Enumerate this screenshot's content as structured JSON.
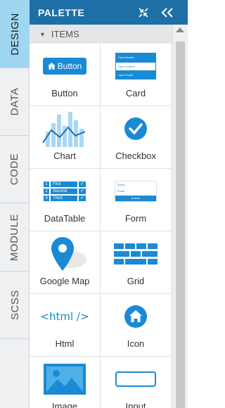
{
  "tabs": [
    {
      "label": "DESIGN",
      "active": true
    },
    {
      "label": "DATA",
      "active": false
    },
    {
      "label": "CODE",
      "active": false
    },
    {
      "label": "MODULE",
      "active": false
    },
    {
      "label": "SCSS",
      "active": false
    }
  ],
  "header": {
    "title": "PALETTE",
    "icons": [
      "collapse-arrows-icon",
      "double-chevron-left-icon"
    ]
  },
  "section": {
    "title": "ITEMS"
  },
  "colors": {
    "accent": "#1e6fa6",
    "icon_blue": "#1a8ad4",
    "active_tab": "#9fd7f2"
  },
  "items": [
    {
      "label": "Button",
      "icon": "button-icon",
      "icon_text": "Button"
    },
    {
      "label": "Card",
      "icon": "card-icon",
      "card_lines": [
        "Card Header",
        "Card Content",
        "Card Footer"
      ]
    },
    {
      "label": "Chart",
      "icon": "chart-icon"
    },
    {
      "label": "Checkbox",
      "icon": "checkbox-icon"
    },
    {
      "label": "DataTable",
      "icon": "datatable-icon",
      "table_rows": [
        [
          "1",
          "First"
        ],
        [
          "2",
          "Second"
        ],
        [
          "3",
          "Third"
        ]
      ]
    },
    {
      "label": "Form",
      "icon": "form-icon",
      "form_fields": [
        "Name",
        "Email"
      ],
      "form_submit": "Submit"
    },
    {
      "label": "Google Map",
      "icon": "map-pin-icon"
    },
    {
      "label": "Grid",
      "icon": "grid-icon"
    },
    {
      "label": "Html",
      "icon": "html-icon",
      "icon_text": "<html />"
    },
    {
      "label": "Icon",
      "icon": "home-icon"
    },
    {
      "label": "Image",
      "icon": "image-icon"
    },
    {
      "label": "Input",
      "icon": "input-icon"
    }
  ]
}
